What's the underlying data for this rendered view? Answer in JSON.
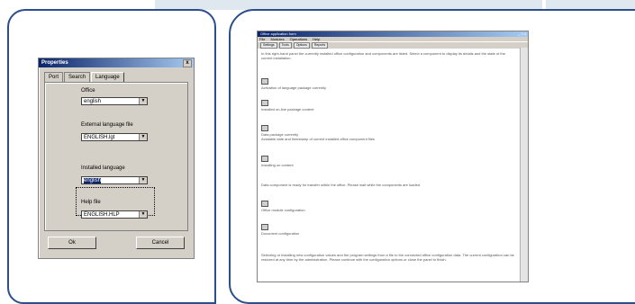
{
  "dialog": {
    "title": "Properties",
    "close": "x",
    "tabs": [
      "Port",
      "Search",
      "Language"
    ],
    "fields": [
      {
        "label": "Office",
        "value": "english"
      },
      {
        "label": "External language file",
        "value": "ENGLISH.lgt"
      },
      {
        "label": "Installed language",
        "value": "english"
      },
      {
        "label": "Help file",
        "value": "ENGLISH.HLP"
      }
    ],
    "ok": "Ok",
    "cancel": "Cancel"
  },
  "app": {
    "title": "Office application form",
    "window_controls": "_ □ x",
    "menus": [
      "File",
      "Modules",
      "Operations",
      "Help"
    ],
    "toolbar": [
      "Settings",
      "Tools",
      "Options",
      "Reports"
    ],
    "intro": "In this right-hand panel the currently installed office configuration and components are listed. Select a component to display its details and the state of the current installation.",
    "items": [
      {
        "text": "Activation of language package currently"
      },
      {
        "text": "Installed on-line package content"
      },
      {
        "text": "Data package currently",
        "sub": "Available date and timestamp of current installed office component files"
      },
      {
        "text": "Installing on content"
      },
      {
        "text": "Data component is ready for transfer within the office. Please wait while the components are loaded."
      },
      {
        "text": "Office module configuration"
      },
      {
        "text": "Document configuration"
      }
    ],
    "footer": "Selecting or installing new configuration values and the program settings from a file to the connected office configuration data. The current configuration can be restored at any time by the administration. Please continue with the configuration options or close the panel to finish."
  }
}
